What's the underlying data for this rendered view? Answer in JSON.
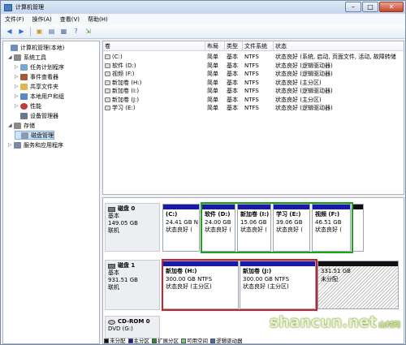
{
  "window": {
    "title": "计算机管理"
  },
  "menu": [
    "文件(F)",
    "操作(A)",
    "查看(V)",
    "帮助(H)"
  ],
  "toolbar": {
    "icons": [
      "back-icon",
      "forward-icon",
      "up-folder-icon",
      "show-hide-tree-icon",
      "properties-icon",
      "help-icon",
      "export-icon",
      "refresh-icon"
    ]
  },
  "tree": {
    "root": "计算机管理(本地)",
    "system_tools": "系统工具",
    "task_scheduler": "任务计划程序",
    "event_viewer": "事件查看器",
    "shared_folders": "共享文件夹",
    "local_users": "本地用户和组",
    "performance": "性能",
    "device_manager": "设备管理器",
    "storage": "存储",
    "disk_mgmt": "磁盘管理",
    "services": "服务和应用程序"
  },
  "columns": [
    "卷",
    "布局",
    "类型",
    "文件系统",
    "状态"
  ],
  "volumes": [
    {
      "name": "(C:)",
      "layout": "简单",
      "type": "基本",
      "fs": "NTFS",
      "status": "状态良好 (系统, 启动, 页面文件, 活动, 故障转储"
    },
    {
      "name": "软件 (D:)",
      "layout": "简单",
      "type": "基本",
      "fs": "NTFS",
      "status": "状态良好 (逻辑驱动器)"
    },
    {
      "name": "视频 (F:)",
      "layout": "简单",
      "type": "基本",
      "fs": "NTFS",
      "status": "状态良好 (逻辑驱动器)"
    },
    {
      "name": "新加卷 (H:)",
      "layout": "简单",
      "type": "基本",
      "fs": "NTFS",
      "status": "状态良好 (主分区)"
    },
    {
      "name": "新加卷 (I:)",
      "layout": "简单",
      "type": "基本",
      "fs": "NTFS",
      "status": "状态良好 (逻辑驱动器)"
    },
    {
      "name": "新加卷 (J:)",
      "layout": "简单",
      "type": "基本",
      "fs": "NTFS",
      "status": "状态良好 (主分区)"
    },
    {
      "name": "学习 (E:)",
      "layout": "简单",
      "type": "基本",
      "fs": "NTFS",
      "status": "状态良好 (逻辑驱动器)"
    }
  ],
  "disks": [
    {
      "name": "磁盘 0",
      "type": "基本",
      "size": "149.05 GB",
      "state": "联机",
      "partitions": [
        {
          "label": "(C:)",
          "size": "24.41 GB N",
          "status": "状态良好 (",
          "color": "#1a1aa6"
        },
        {
          "label": "软件 (D:)",
          "size": "24.00 GB",
          "status": "状态良好 (",
          "color": "#1a1aa6"
        },
        {
          "label": "新加卷 (I:)",
          "size": "15.06 GB",
          "status": "状态良好 (",
          "color": "#1a1aa6"
        },
        {
          "label": "学习 (E:)",
          "size": "39.06 GB",
          "status": "状态良好 (",
          "color": "#1a1aa6"
        },
        {
          "label": "视频 (F:)",
          "size": "46.51 GB",
          "status": "状态良好 (",
          "color": "#1a1aa6"
        }
      ]
    },
    {
      "name": "磁盘 1",
      "type": "基本",
      "size": "931.51 GB",
      "state": "联机",
      "partitions": [
        {
          "label": "新加卷 (H:)",
          "size": "300.00 GB NTFS",
          "status": "状态良好 (主分区)",
          "color": "#1a1aa6"
        },
        {
          "label": "新加卷 (J:)",
          "size": "300.00 GB NTFS",
          "status": "状态良好 (主分区)",
          "color": "#1a1aa6"
        },
        {
          "label": "",
          "size": "331.51 GB",
          "status": "未分配",
          "color": "#111111"
        }
      ]
    },
    {
      "name": "CD-ROM 0",
      "type": "DVD (G:)",
      "size": "",
      "state": "",
      "partitions": []
    }
  ],
  "legend": [
    {
      "label": "未分配",
      "color": "#111111"
    },
    {
      "label": "主分区",
      "color": "#1a1aa6"
    },
    {
      "label": "扩展分区",
      "color": "#2e8b2e"
    },
    {
      "label": "可用空间",
      "color": "#7ad07a"
    },
    {
      "label": "逻辑驱动器",
      "color": "#3c6ec8"
    }
  ],
  "watermark": {
    "text": "shancun",
    "suffix": ".net",
    "tag": "山村网"
  }
}
